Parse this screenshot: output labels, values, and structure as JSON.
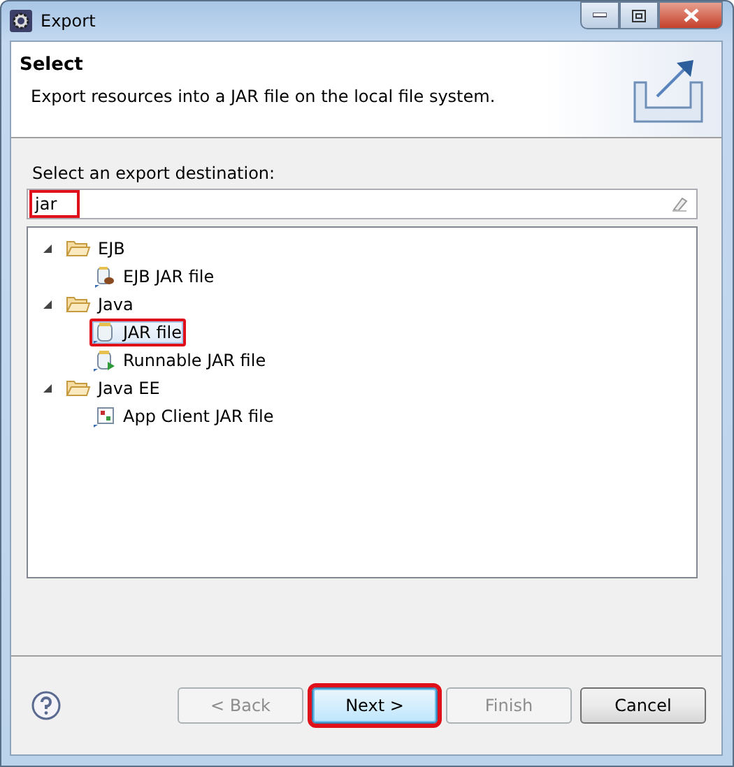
{
  "window": {
    "title": "Export"
  },
  "header": {
    "title": "Select",
    "description": "Export resources into a JAR file on the local file system."
  },
  "destination": {
    "label": "Select an export destination:",
    "value": "jar",
    "highlighted": true
  },
  "tree": [
    {
      "label": "EJB",
      "expanded": true,
      "children": [
        {
          "label": "EJB JAR file",
          "kind": "ejb-jar",
          "selected": false,
          "highlighted": false
        }
      ]
    },
    {
      "label": "Java",
      "expanded": true,
      "children": [
        {
          "label": "JAR file",
          "kind": "jar",
          "selected": true,
          "highlighted": true
        },
        {
          "label": "Runnable JAR file",
          "kind": "runnable-jar",
          "selected": false,
          "highlighted": false
        }
      ]
    },
    {
      "label": "Java EE",
      "expanded": true,
      "children": [
        {
          "label": "App Client JAR file",
          "kind": "app-client",
          "selected": false,
          "highlighted": false
        }
      ]
    }
  ],
  "buttons": [
    {
      "label": "< Back",
      "disabled": true,
      "default": false,
      "highlighted": false
    },
    {
      "label": "Next >",
      "disabled": false,
      "default": true,
      "highlighted": true
    },
    {
      "label": "Finish",
      "disabled": true,
      "default": false,
      "highlighted": false
    },
    {
      "label": "Cancel",
      "disabled": false,
      "default": false,
      "highlighted": false
    }
  ]
}
